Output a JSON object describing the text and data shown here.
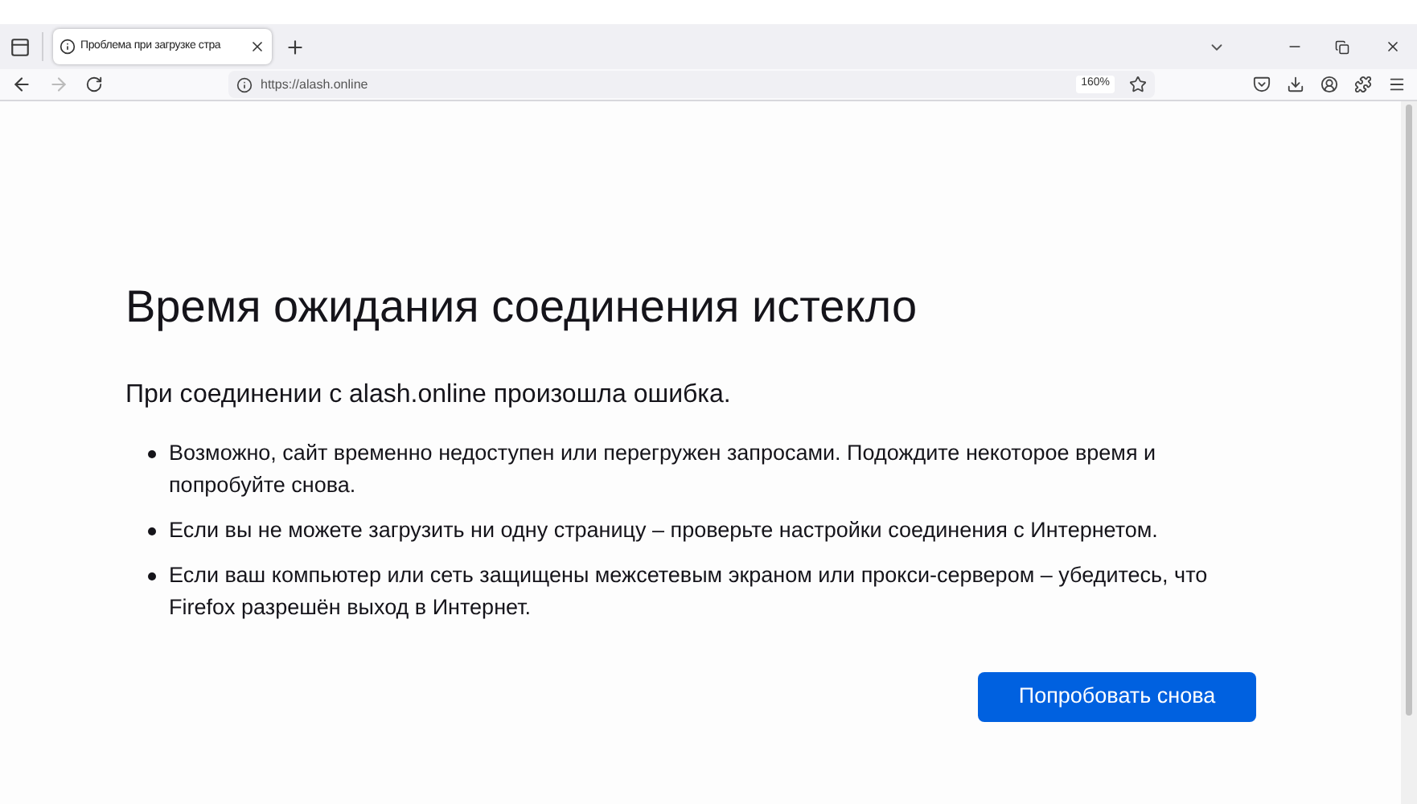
{
  "tabs": [
    {
      "title": "Проблема при загрузке стра",
      "selected": true
    }
  ],
  "address_bar": {
    "url": "https://alash.online",
    "zoom": "160%"
  },
  "error_page": {
    "title": "Время ожидания соединения истекло",
    "intro": "При соединении с alash.online произошла ошибка.",
    "bullets": [
      "Возможно, сайт временно недоступен или перегружен запросами. Подождите некоторое время и попробуйте снова.",
      "Если вы не можете загрузить ни одну страницу – проверьте настройки соединения с Интернетом.",
      "Если ваш компьютер или сеть защищены межсетевым экраном или прокси-сервером – убедитесь, что Firefox разрешён выход в Интернет."
    ],
    "button": "Попробовать снова"
  }
}
